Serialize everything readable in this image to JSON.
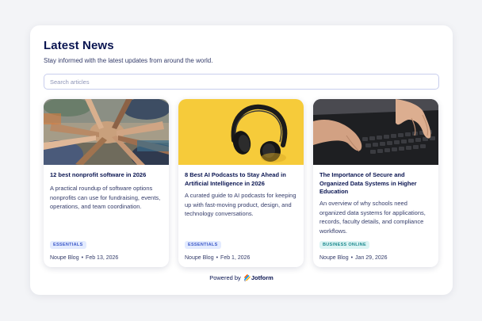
{
  "header": {
    "title": "Latest News",
    "subtitle": "Stay informed with the latest updates from around the world."
  },
  "search": {
    "placeholder": "Search articles",
    "value": ""
  },
  "articles": [
    {
      "title": "12 best nonprofit software in 2026",
      "description": "A practical roundup of software options nonprofits can use for fundraising, events, operations, and team coordination.",
      "badge": "ESSENTIALS",
      "source": "Noupe Blog",
      "date": "Feb 13, 2026",
      "image": "hands-together-photo"
    },
    {
      "title": "8 Best AI Podcasts to Stay Ahead in Artificial Intelligence in 2026",
      "description": "A curated guide to AI podcasts for keeping up with fast-moving product, design, and technology conversations.",
      "badge": "ESSENTIALS",
      "source": "Noupe Blog",
      "date": "Feb 1, 2026",
      "image": "headphones-on-yellow-photo"
    },
    {
      "title": "The Importance of Secure and Organized Data Systems in Higher Education",
      "description": "An overview of why schools need organized data systems for applications, records, faculty details, and compliance workflows.",
      "badge": "BUSINESS ONLINE",
      "source": "Noupe Blog",
      "date": "Jan 29, 2026",
      "image": "laptop-typing-photo"
    }
  ],
  "footer": {
    "powered_by": "Powered by",
    "brand": "Jotform"
  },
  "colors": {
    "background": "#f3f4f7",
    "navy": "#0a1551",
    "badge_blue_bg": "#e3ebff",
    "badge_teal_bg": "#ddf4f4",
    "podcast_yellow": "#f6cb3a"
  }
}
